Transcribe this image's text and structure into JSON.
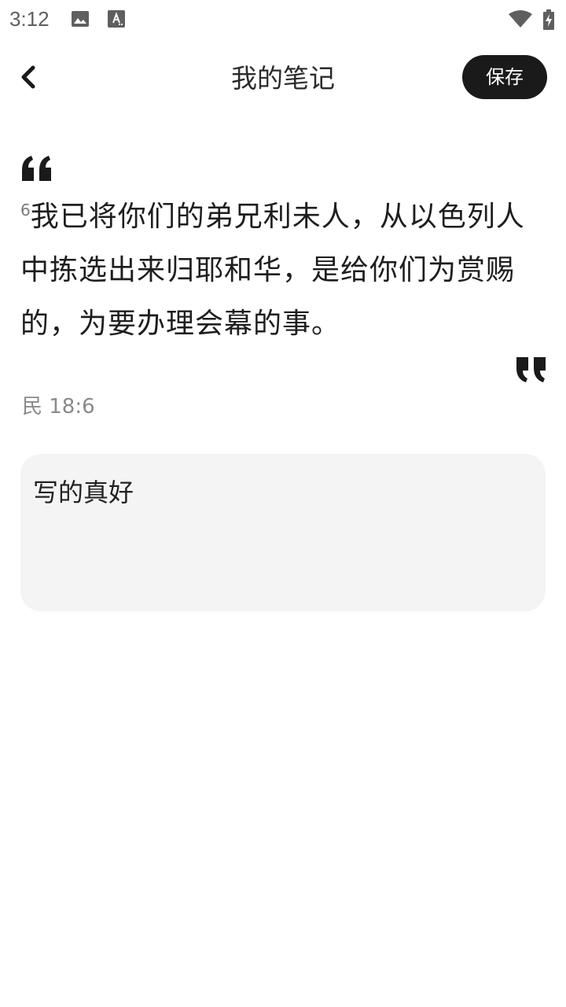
{
  "status_bar": {
    "time": "3:12",
    "icons": [
      "image-icon",
      "accessibility-text-icon",
      "wifi-icon",
      "battery-charging-icon"
    ]
  },
  "app_bar": {
    "back_icon": "chevron-left-icon",
    "title": "我的笔记",
    "save_label": "保存"
  },
  "quote": {
    "verse_number": "6",
    "verse_text": "我已将你们的弟兄利未人，从以色列人中拣选出来归耶和华，是给你们为赏赐的，为要办理会幕的事。",
    "reference": "民 18:6",
    "open_icon": "quote-open-icon",
    "close_icon": "quote-close-icon"
  },
  "note": {
    "value": "写的真好",
    "placeholder": ""
  },
  "colors": {
    "accent": "#1a1a1a",
    "note_background": "#f4f4f4",
    "muted_text": "#8a8a8a"
  }
}
